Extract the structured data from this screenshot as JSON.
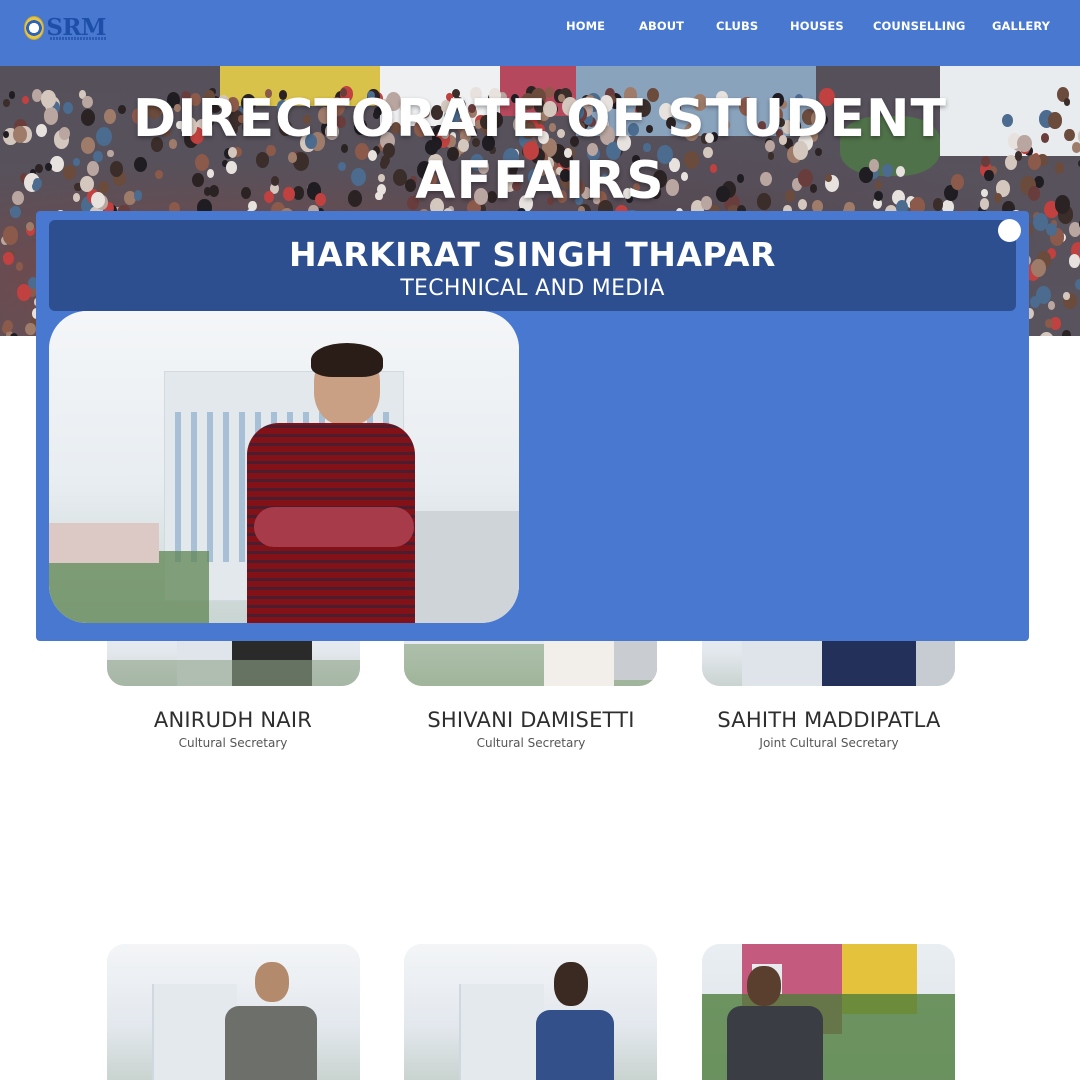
{
  "brand": {
    "logo_text": "SRM"
  },
  "nav": {
    "items": [
      "HOME",
      "ABOUT",
      "CLUBS",
      "HOUSES",
      "COUNSELLING",
      "GALLERY"
    ]
  },
  "hero": {
    "title_line1": "DIRECTORATE OF STUDENT",
    "title_line2": "AFFAIRS"
  },
  "modal": {
    "name": "HARKIRAT SINGH THAPAR",
    "department": "TECHNICAL AND MEDIA"
  },
  "members": [
    {
      "name": "ANIRUDH NAIR",
      "role": "Cultural Secretary"
    },
    {
      "name": "SHIVANI DAMISETTI",
      "role": "Cultural Secretary"
    },
    {
      "name": "SAHITH MADDIPATLA",
      "role": "Joint Cultural Secretary"
    }
  ],
  "colors": {
    "navbar": "#4878cf",
    "modal_bg": "#4878cf",
    "modal_header": "#2e4f8f",
    "text_dark": "#2e2e2e"
  },
  "icons": {
    "close": "close-icon",
    "logo": "srm-emblem-icon"
  }
}
